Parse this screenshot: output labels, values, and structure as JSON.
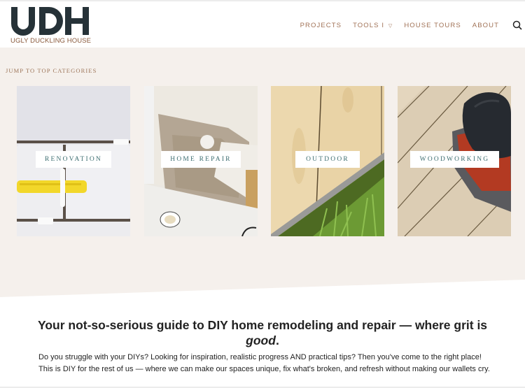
{
  "brand": {
    "logo_letters": "UDH",
    "logo_tagline": "UGLY DUCKLING HOUSE",
    "colors": {
      "logo_dark": "#263238",
      "brand_brown": "#8a5a3c",
      "nav_text": "#a07155",
      "card_label_text": "#3c6d70",
      "hero_bg": "#f5f0ec"
    }
  },
  "nav": {
    "items": [
      {
        "label": "PROJECTS"
      },
      {
        "label": "TOOLS I",
        "has_dropdown": true,
        "caret": "▽"
      },
      {
        "label": "HOUSE TOURS"
      },
      {
        "label": "ABOUT"
      }
    ],
    "search_icon": "search-icon"
  },
  "hero": {
    "jump_label": "JUMP TO TOP CATEGORIES",
    "categories": [
      {
        "label": "RENOVATION",
        "image": "white subway tiles with yellow spacer tool"
      },
      {
        "label": "HOME REPAIR",
        "image": "patched bathroom wall with toilet flange"
      },
      {
        "label": "OUTDOOR",
        "image": "pine deck boards over grass"
      },
      {
        "label": "WOODWORKING",
        "image": "red orbital sander on deck boards"
      }
    ]
  },
  "intro": {
    "tagline_main": "Your not-so-serious guide to DIY home remodeling and repair — where grit is",
    "tagline_em": "good",
    "tagline_end": ".",
    "paragraph": "Do you struggle with your DIYs? Looking for inspiration, realistic progress AND practical tips? Then you've come to the right place! This is DIY for the rest of us — where we can make our spaces unique, fix what's broken, and refresh without making our wallets cry."
  }
}
